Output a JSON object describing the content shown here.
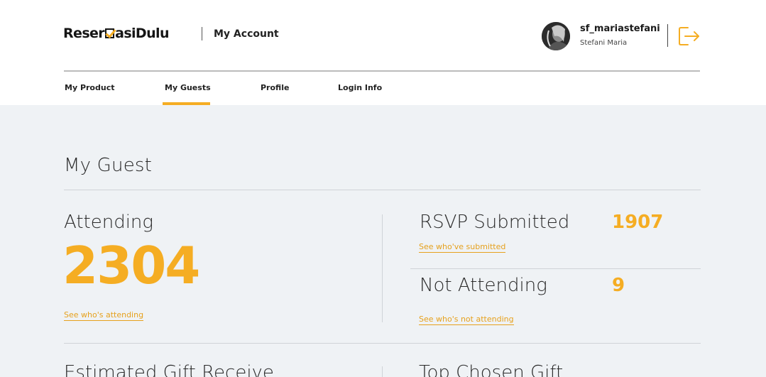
{
  "header": {
    "logo_text_a": "Reser",
    "logo_text_b": "asiDulu",
    "section_title": "My Account"
  },
  "user": {
    "username": "sf_mariastefani",
    "full_name": "Stefani Maria"
  },
  "tabs": [
    {
      "label": "My Product",
      "active": false
    },
    {
      "label": "My Guests",
      "active": true
    },
    {
      "label": "Profile",
      "active": false
    },
    {
      "label": "Login Info",
      "active": false
    }
  ],
  "main": {
    "title": "My Guest",
    "attending": {
      "label": "Attending",
      "value": "2304",
      "link": "See who's attending"
    },
    "rsvp": {
      "label": "RSVP Submitted",
      "value": "1907",
      "link": "See who've submitted"
    },
    "not_attending": {
      "label": "Not Attending",
      "value": "9",
      "link": "See who's not attending"
    },
    "gift_estimate_label": "Estimated Gift Receive",
    "top_gift_label": "Top Chosen Gift"
  },
  "colors": {
    "accent": "#f5ad23",
    "background": "#eff2f5",
    "header_bg": "#ffffff"
  },
  "icons": {
    "logout": "logout-icon",
    "logo_check": "checkbox-check-icon"
  }
}
